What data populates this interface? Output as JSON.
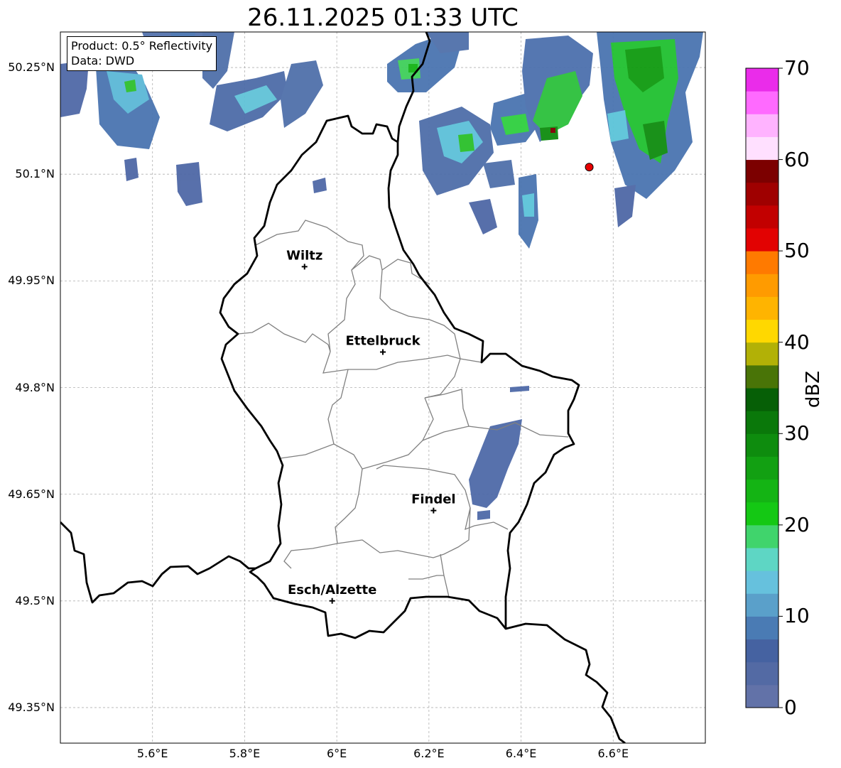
{
  "title": "26.11.2025 01:33 UTC",
  "legend": {
    "product": "Product: 0.5° Reflectivity",
    "source": "Data: DWD"
  },
  "colorbar": {
    "label": "dBZ",
    "ticks": [
      "0",
      "10",
      "20",
      "30",
      "40",
      "50",
      "60",
      "70"
    ],
    "min": 0,
    "max": 70,
    "step": 2.5,
    "colors": [
      "#6272a8",
      "#536aa4",
      "#4562a1",
      "#4a7bb4",
      "#5aa0ca",
      "#66c1dd",
      "#5ed6c4",
      "#40d46c",
      "#14c814",
      "#14b414",
      "#12a012",
      "#0e8c0e",
      "#0a780a",
      "#065f06",
      "#497407",
      "#b2b106",
      "#ffd800",
      "#ffb400",
      "#ff9b00",
      "#ff7a00",
      "#e20202",
      "#c20000",
      "#9f0000",
      "#7c0000",
      "#ffe0ff",
      "#ffb3ff",
      "#ff6aff",
      "#ea2cea"
    ]
  },
  "axes": {
    "x_ticks": [
      {
        "value": 5.6,
        "label": "5.6°E"
      },
      {
        "value": 5.8,
        "label": "5.8°E"
      },
      {
        "value": 6.0,
        "label": "6°E"
      },
      {
        "value": 6.2,
        "label": "6.2°E"
      },
      {
        "value": 6.4,
        "label": "6.4°E"
      },
      {
        "value": 6.6,
        "label": "6.6°E"
      }
    ],
    "y_ticks": [
      {
        "value": 50.25,
        "label": "50.25°N"
      },
      {
        "value": 50.1,
        "label": "50.1°N"
      },
      {
        "value": 49.95,
        "label": "49.95°N"
      },
      {
        "value": 49.8,
        "label": "49.8°N"
      },
      {
        "value": 49.65,
        "label": "49.65°N"
      },
      {
        "value": 49.5,
        "label": "49.5°N"
      },
      {
        "value": 49.35,
        "label": "49.35°N"
      }
    ],
    "lon_range": [
      5.4,
      6.8
    ],
    "lat_range": [
      49.3,
      50.3
    ],
    "grid": true
  },
  "cities": [
    {
      "name": "Wiltz",
      "lon": 5.93,
      "lat": 49.97
    },
    {
      "name": "Ettelbruck",
      "lon": 6.1,
      "lat": 49.85
    },
    {
      "name": "Findel",
      "lon": 6.21,
      "lat": 49.627
    },
    {
      "name": "Esch/Alzette",
      "lon": 5.99,
      "lat": 49.5
    }
  ],
  "radar_site": {
    "lon": 6.548,
    "lat": 50.11,
    "color": "#e80000"
  },
  "colors": {
    "border": "#000000",
    "cantons": "#808080",
    "grid": "#b0b0b0"
  }
}
